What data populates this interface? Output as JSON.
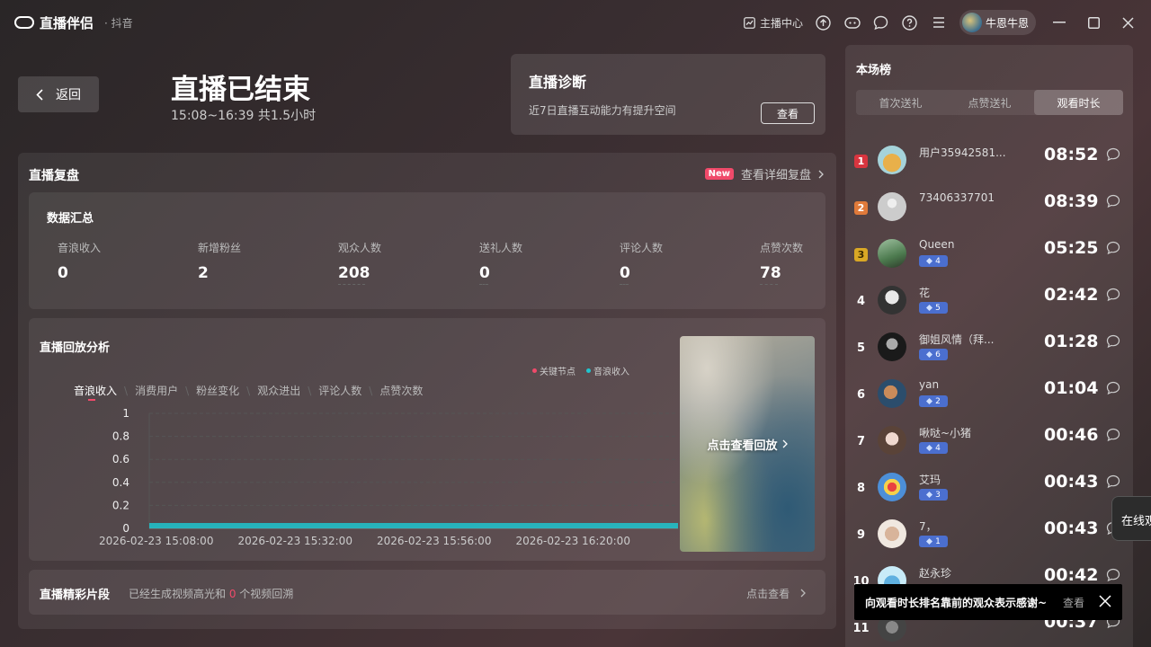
{
  "app": {
    "name": "直播伴侣",
    "sub": "· 抖音"
  },
  "titlebar": {
    "creator_center": "主播中心",
    "username": "牛恩牛恩"
  },
  "header": {
    "back_label": "返回",
    "title": "直播已结束",
    "subtitle": "15:08~16:39 共1.5小时"
  },
  "diagnosis": {
    "title": "直播诊断",
    "desc": "近7日直播互动能力有提升空间",
    "button": "查看"
  },
  "review": {
    "title": "直播复盘",
    "badge": "New",
    "link": "查看详细复盘"
  },
  "summary": {
    "title": "数据汇总",
    "stats": [
      {
        "label": "音浪收入",
        "value": "0"
      },
      {
        "label": "新增粉丝",
        "value": "2"
      },
      {
        "label": "观众人数",
        "value": "208"
      },
      {
        "label": "送礼人数",
        "value": "0"
      },
      {
        "label": "评论人数",
        "value": "0"
      },
      {
        "label": "点赞次数",
        "value": "78"
      }
    ]
  },
  "playback": {
    "title": "直播回放分析",
    "legend": [
      {
        "label": "关键节点",
        "color": "#f04a6a"
      },
      {
        "label": "音浪收入",
        "color": "#1fc5cf"
      }
    ],
    "tabs": [
      "音浪收入",
      "消费用户",
      "粉丝变化",
      "观众进出",
      "评论人数",
      "点赞次数"
    ],
    "video_label": "点击查看回放"
  },
  "chart_data": {
    "type": "area",
    "series": [
      {
        "name": "音浪收入",
        "color": "#1fc5cf",
        "values": [
          0,
          0,
          0,
          0,
          0
        ]
      }
    ],
    "x": [
      "2026-02-23 15:08:00",
      "2026-02-23 15:32:00",
      "2026-02-23 15:56:00",
      "2026-02-23 16:20:00",
      "2026-02-23 16:39:00"
    ],
    "x_tick_labels": [
      "2026-02-23 15:08:00",
      "2026-02-23 15:32:00",
      "2026-02-23 15:56:00",
      "2026-02-23 16:20:00"
    ],
    "y_ticks": [
      "1",
      "0.8",
      "0.6",
      "0.4",
      "0.2",
      "0"
    ],
    "ylim": [
      0,
      1
    ],
    "grid": true
  },
  "highlight": {
    "title": "直播精彩片段",
    "desc_prefix": "已经生成视频高光和 ",
    "count": "0",
    "desc_suffix": " 个视频回溯",
    "link": "点击查看"
  },
  "ranking": {
    "title": "本场榜",
    "tabs": [
      "首次送礼",
      "点赞送礼",
      "观看时长"
    ],
    "active_tab": 2,
    "rows": [
      {
        "rank": "1",
        "name": "用户35942581...",
        "level": "",
        "time": "08:52"
      },
      {
        "rank": "2",
        "name": "73406337701",
        "level": "",
        "time": "08:39"
      },
      {
        "rank": "3",
        "name": "Queen",
        "level": "4",
        "time": "05:25"
      },
      {
        "rank": "4",
        "name": "花",
        "level": "5",
        "time": "02:42"
      },
      {
        "rank": "5",
        "name": "御姐风情（拜...",
        "level": "6",
        "time": "01:28"
      },
      {
        "rank": "6",
        "name": "yan",
        "level": "2",
        "time": "01:04"
      },
      {
        "rank": "7",
        "name": "啾哒~小猪",
        "level": "4",
        "time": "00:46"
      },
      {
        "rank": "8",
        "name": "艾玛",
        "level": "3",
        "time": "00:43"
      },
      {
        "rank": "9",
        "name": "7，",
        "level": "1",
        "time": "00:43"
      },
      {
        "rank": "10",
        "name": "赵永珍",
        "level": "",
        "time": "00:42"
      },
      {
        "rank": "11",
        "name": "",
        "level": "",
        "time": "00:37"
      }
    ]
  },
  "toast": {
    "text": "向观看时长排名靠前的观众表示感谢~",
    "view": "查看"
  },
  "online_tab": {
    "label": "在线观众"
  }
}
